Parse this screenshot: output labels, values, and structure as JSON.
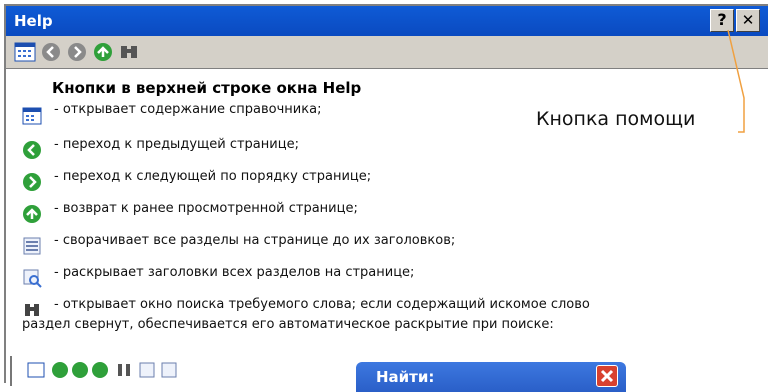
{
  "window": {
    "title": "Help",
    "help_button_label": "?",
    "close_button_label": "✕"
  },
  "toolbar": {
    "icons": [
      "contents-icon",
      "back-icon",
      "forward-icon",
      "home-icon",
      "search-icon"
    ]
  },
  "content": {
    "heading": "Кнопки в верхней строке окна Help",
    "rows": [
      {
        "icon": "contents-icon",
        "text": "- открывает содержание справочника;"
      },
      {
        "icon": "back-icon",
        "text": "- переход к предыдущей странице;"
      },
      {
        "icon": "forward-icon",
        "text": "- переход к следующей по порядку странице;"
      },
      {
        "icon": "home-icon",
        "text": "- возврат к ранее просмотренной странице;"
      },
      {
        "icon": "collapse-icon",
        "text": "- сворачивает все разделы на странице до их заголовков;"
      },
      {
        "icon": "expand-icon",
        "text": "- раскрывает заголовки всех разделов на странице;"
      },
      {
        "icon": "search-icon",
        "text": "- открывает окно поиска требуемого слова; если содержащий искомое слово"
      }
    ],
    "row_continuation": "раздел свернут, обеспечивается его автоматическое раскрытие при поиске:"
  },
  "annotation": {
    "callout_text": "Кнопка помощи",
    "leader_color": "#f0a040"
  },
  "preview": {
    "find_title": "Найти:"
  },
  "colors": {
    "titlebar": "#0f5bd6",
    "green_button": "#2fa03a",
    "grey_button": "#8a8a8a"
  }
}
